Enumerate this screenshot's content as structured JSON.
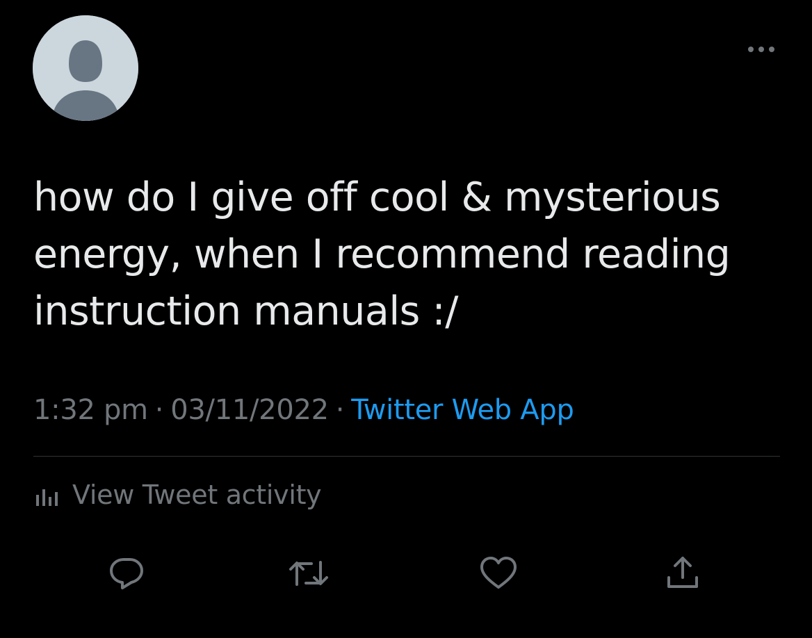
{
  "header": {
    "display_name": "",
    "handle": "",
    "more_icon": "more-horizontal-icon"
  },
  "tweet": {
    "text_lines": [
      "how do I give off cool & mysterious",
      "energy, when I recommend reading",
      "instruction manuals :/"
    ],
    "time": "1:32 pm",
    "separator": "·",
    "date": "03/11/2022",
    "source": "Twitter Web App"
  },
  "activity": {
    "icon": "bar-chart-icon",
    "label": "View Tweet activity"
  },
  "actions": {
    "reply_icon": "reply-icon",
    "retweet_icon": "retweet-icon",
    "like_icon": "like-icon",
    "share_icon": "share-icon"
  },
  "colors": {
    "background": "#000000",
    "text": "#e7e9ea",
    "secondary": "#71767b",
    "accent": "#1d9bf0",
    "avatar_bg": "#ccd6dd",
    "avatar_fg": "#687684",
    "divider": "#2f3336"
  }
}
